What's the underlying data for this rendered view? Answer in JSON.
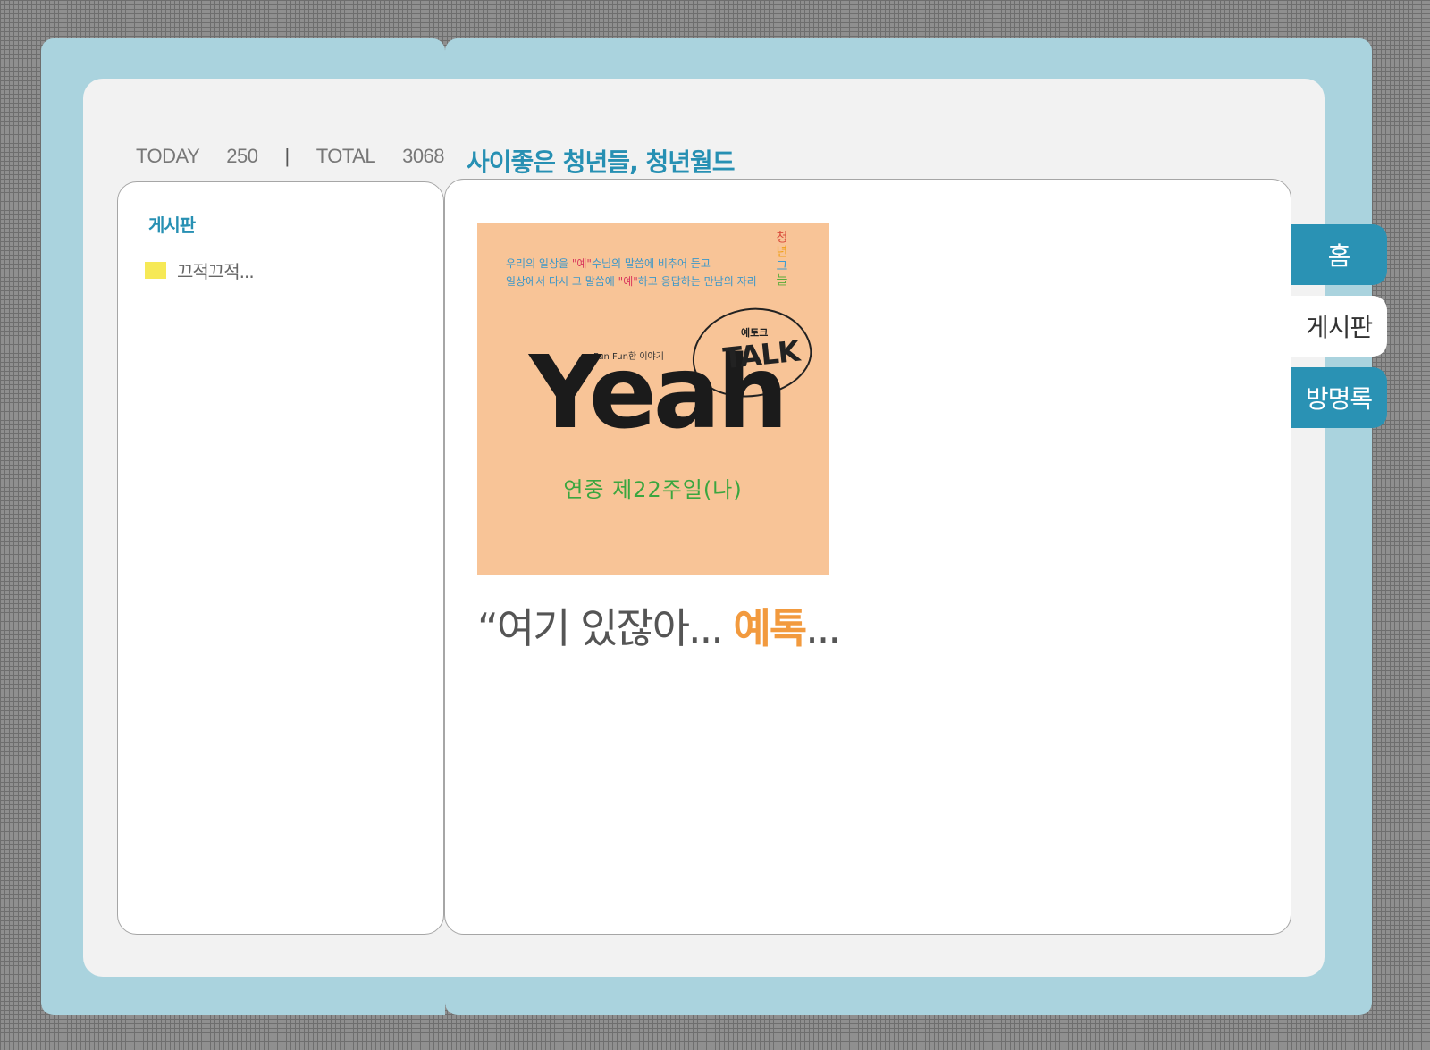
{
  "counter": {
    "today_label": "TODAY",
    "today_value": "250",
    "separator": "|",
    "total_label": "TOTAL",
    "total_value": "3068"
  },
  "site": {
    "title": "사이좋은 청년들, 청년월드"
  },
  "sidebar": {
    "title": "게시판",
    "items": [
      {
        "label": "끄적끄적..."
      }
    ]
  },
  "poster": {
    "line1_a": "우리의 일상을 ",
    "line1_hl": "\"예\"",
    "line1_b": "수님의 말씀에 비추어 듣고",
    "line2_a": "일상에서 다시 그 말씀에 ",
    "line2_hl": "\"예\"",
    "line2_b": "하고 응답하는 만남의 자리",
    "stamp": [
      "청",
      "년",
      "그",
      "늘"
    ],
    "fun_text": "Fun Fun한 이야기",
    "yeah": "Yeah",
    "talk_small": "예토크",
    "talk": "TALK",
    "week": "연중 제22주일(나)"
  },
  "main": {
    "quote_prefix": "“여기 있잖아... ",
    "quote_accent": "예톡",
    "quote_suffix": "..."
  },
  "tabs": [
    {
      "label": "홈",
      "state": "inactive"
    },
    {
      "label": "게시판",
      "state": "active"
    },
    {
      "label": "방명록",
      "state": "inactive"
    }
  ],
  "colors": {
    "frame": "#aad3de",
    "accent": "#2790b3",
    "quote_accent": "#f29a3e",
    "folder": "#f6e956",
    "poster_bg": "#f8c497"
  }
}
